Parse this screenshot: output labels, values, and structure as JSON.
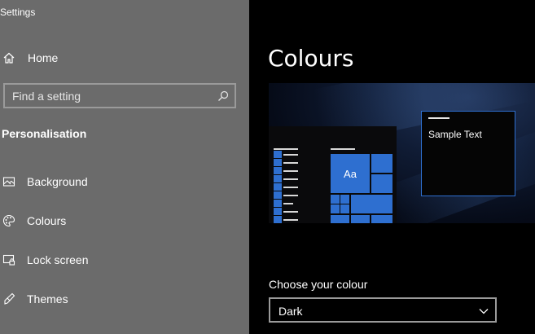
{
  "window": {
    "title": "Settings"
  },
  "sidebar": {
    "home_label": "Home",
    "search": {
      "placeholder": "Find a setting",
      "value": ""
    },
    "section_heading": "Personalisation",
    "items": [
      {
        "label": "Background",
        "icon": "image-icon"
      },
      {
        "label": "Colours",
        "icon": "palette-icon"
      },
      {
        "label": "Lock screen",
        "icon": "lock-screen-icon"
      },
      {
        "label": "Themes",
        "icon": "themes-icon"
      }
    ]
  },
  "main": {
    "title": "Colours",
    "preview": {
      "tile_text": "Aa",
      "sample_text": "Sample Text"
    },
    "choose_colour": {
      "label": "Choose your colour",
      "value": "Dark"
    }
  },
  "colors": {
    "sidebar_bg": "#6b6b6b",
    "main_bg": "#000000",
    "accent": "#2e6fd0"
  }
}
